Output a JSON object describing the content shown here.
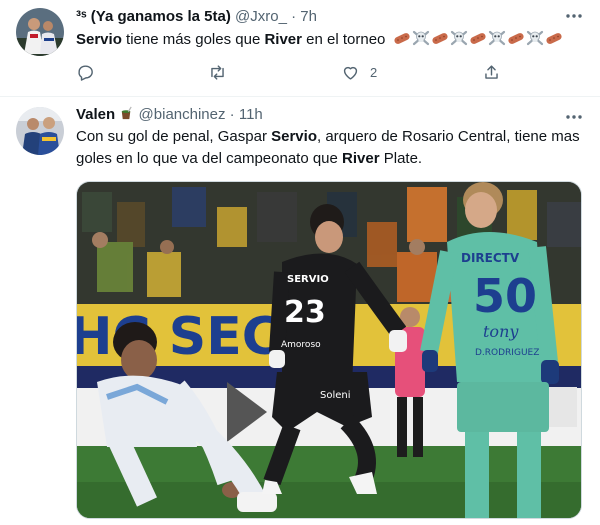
{
  "tweet1": {
    "display_name": "³ˢ (Ya ganamos la 5ta)",
    "handle": "@Jxro_",
    "time": "· 7h",
    "text_parts": [
      "Servio",
      " tiene más goles que ",
      "River",
      " en el torneo"
    ],
    "emoji_sequence": [
      "sausage",
      "skull-crossbones",
      "sausage",
      "skull-crossbones",
      "sausage",
      "skull-crossbones",
      "sausage",
      "skull-crossbones",
      "sausage"
    ],
    "reply_count": "",
    "retweet_count": "",
    "like_count": "2",
    "icons": [
      "reply-icon",
      "retweet-icon",
      "like-icon",
      "share-icon",
      "more-icon"
    ]
  },
  "tweet2": {
    "display_name": "Valen",
    "name_emoji": "mate-icon",
    "handle": "@bianchinez",
    "time": "· 11h",
    "text_parts": [
      "Con su gol de penal, Gaspar ",
      "Servio",
      ", arquero de Rosario Central, tiene mas goles en lo que va del campeonato que ",
      "River",
      " Plate."
    ],
    "image": {
      "banner_text": "HC SEC",
      "goalkeeper_shirt_name": "SERVIO",
      "goalkeeper_number": "23",
      "goalkeeper_sponsor": "Amoroso",
      "shorts_sponsor": "Soleni",
      "defender_shirt_top": "DIRECTV",
      "defender_number": "50",
      "defender_sponsor": "tony",
      "defender_name": "D.RODRIGUEZ"
    }
  },
  "colors": {
    "text": "#0f1419",
    "muted": "#536471",
    "divider": "#eff3f4",
    "stadium_yellow": "#e2c23a",
    "goalkeeper_kit": "#1b1b1d",
    "defender_kit": "#5fbfa6",
    "pitch": "#3d7a35"
  }
}
